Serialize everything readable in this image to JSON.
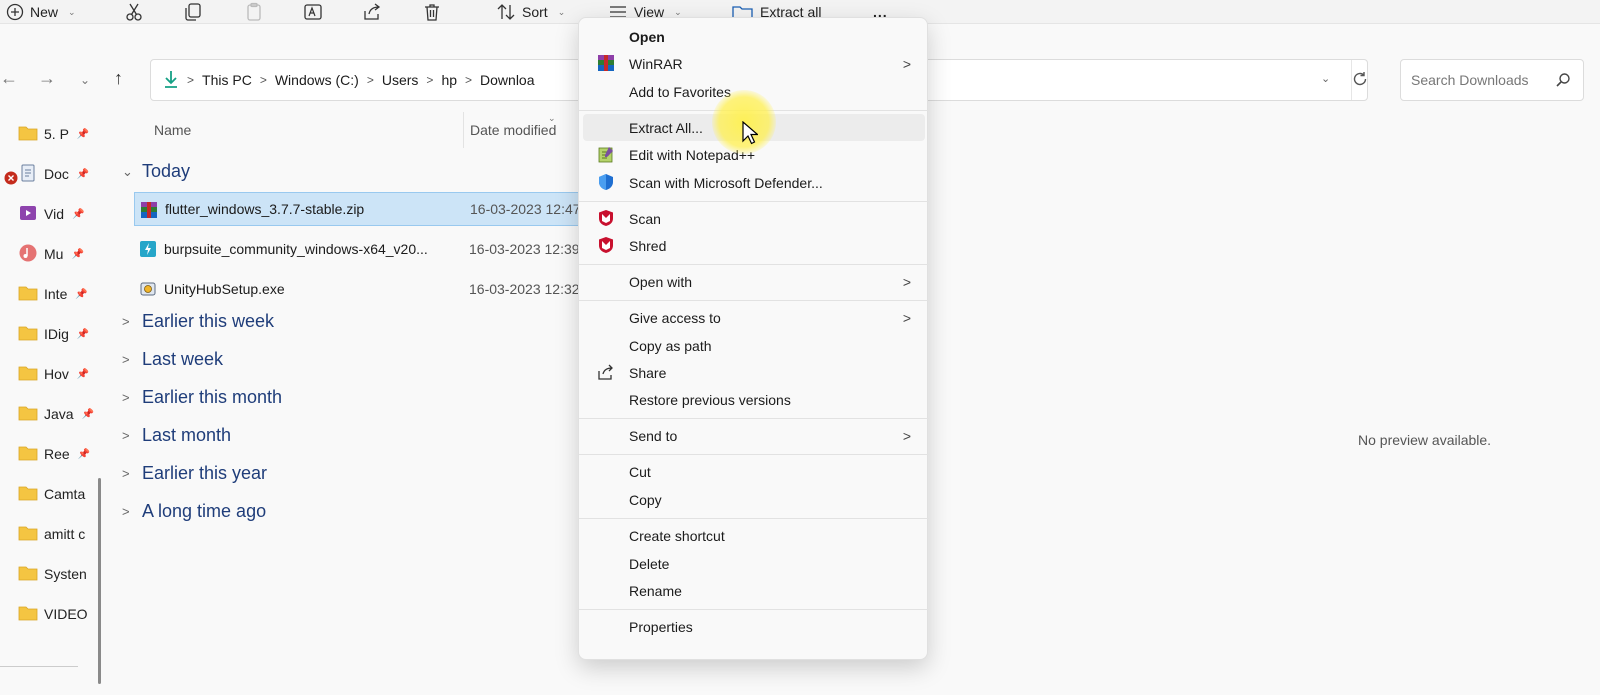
{
  "toolbar": {
    "new_label": "New",
    "sort_label": "Sort",
    "view_label": "View",
    "extract_all_label": "Extract all",
    "more_label": "..."
  },
  "address": {
    "crumbs": [
      "This PC",
      "Windows (C:)",
      "Users",
      "hp",
      "Downloa"
    ],
    "search_placeholder": "Search Downloads"
  },
  "sidebar": {
    "items": [
      {
        "label": "5. P",
        "icon": "folder-icon"
      },
      {
        "label": "Doc",
        "icon": "document-icon"
      },
      {
        "label": "Vid",
        "icon": "video-icon"
      },
      {
        "label": "Mu",
        "icon": "music-icon"
      },
      {
        "label": "Inte",
        "icon": "folder-icon"
      },
      {
        "label": "IDig",
        "icon": "folder-icon"
      },
      {
        "label": "Hov",
        "icon": "folder-icon"
      },
      {
        "label": "Java",
        "icon": "folder-icon"
      },
      {
        "label": "Ree",
        "icon": "folder-icon"
      },
      {
        "label": "Camta",
        "icon": "folder-icon"
      },
      {
        "label": "amitt c",
        "icon": "folder-icon"
      },
      {
        "label": "Systen",
        "icon": "folder-icon"
      },
      {
        "label": "VIDEO",
        "icon": "folder-icon"
      }
    ]
  },
  "columns": {
    "name": "Name",
    "date_modified": "Date modified"
  },
  "groups": {
    "today": "Today",
    "earlier_week": "Earlier this week",
    "last_week": "Last week",
    "earlier_month": "Earlier this month",
    "last_month": "Last month",
    "earlier_year": "Earlier this year",
    "long_ago": "A long time ago"
  },
  "files": [
    {
      "name": "flutter_windows_3.7.7-stable.zip",
      "date": "16-03-2023 12:47",
      "icon": "winrar-archive-icon"
    },
    {
      "name": "burpsuite_community_windows-x64_v20...",
      "date": "16-03-2023 12:39",
      "icon": "burpsuite-icon"
    },
    {
      "name": "UnityHubSetup.exe",
      "date": "16-03-2023 12:32",
      "icon": "installer-icon"
    }
  ],
  "preview": {
    "text": "No preview available."
  },
  "context_menu": {
    "open": "Open",
    "winrar": "WinRAR",
    "add_favorites": "Add to Favorites",
    "extract_all": "Extract All...",
    "edit_notepad": "Edit with Notepad++",
    "scan_defender": "Scan with Microsoft Defender...",
    "scan": "Scan",
    "shred": "Shred",
    "open_with": "Open with",
    "give_access": "Give access to",
    "copy_path": "Copy as path",
    "share": "Share",
    "restore": "Restore previous versions",
    "send_to": "Send to",
    "cut": "Cut",
    "copy": "Copy",
    "create_shortcut": "Create shortcut",
    "delete": "Delete",
    "rename": "Rename",
    "properties": "Properties"
  },
  "colors": {
    "selection": "#cce4f7",
    "group_header": "#1f3d7a",
    "mcafee_red": "#c8102e"
  }
}
